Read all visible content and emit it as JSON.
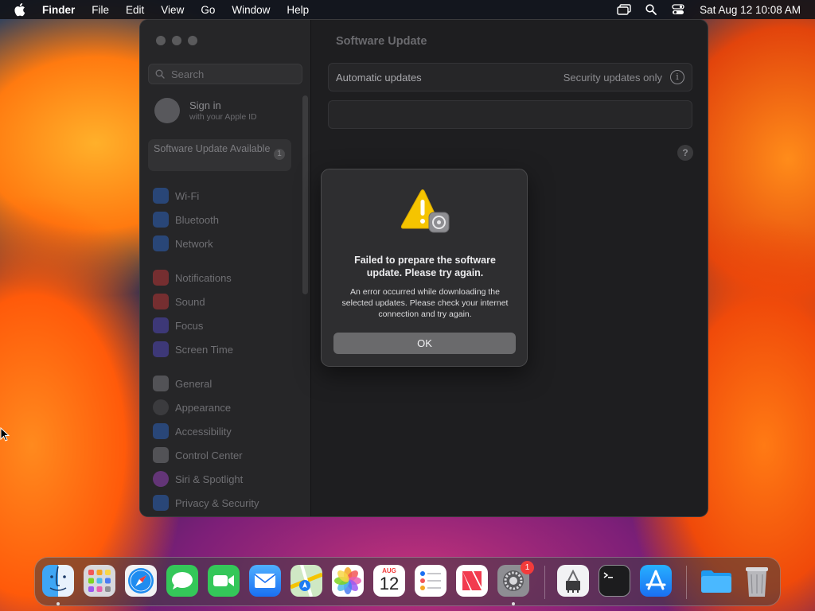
{
  "menubar": {
    "app_name": "Finder",
    "items": [
      "File",
      "Edit",
      "View",
      "Go",
      "Window",
      "Help"
    ],
    "clock": "Sat Aug 12  10:08 AM"
  },
  "sidebar": {
    "search_placeholder": "Search",
    "sign_in_title": "Sign in",
    "sign_in_subtitle": "with your Apple ID",
    "software_update_label": "Software Update Available",
    "software_update_badge": "1",
    "items": [
      {
        "label": "Wi-Fi",
        "color": "#2f6fd6"
      },
      {
        "label": "Bluetooth",
        "color": "#2f6fd6"
      },
      {
        "label": "Network",
        "color": "#2f6fd6"
      },
      {
        "label": "Notifications",
        "color": "#d63a3a"
      },
      {
        "label": "Sound",
        "color": "#d63a3a"
      },
      {
        "label": "Focus",
        "color": "#5a4fd6"
      },
      {
        "label": "Screen Time",
        "color": "#5a4fd6"
      },
      {
        "label": "General",
        "color": "#8a8a8e"
      },
      {
        "label": "Appearance",
        "color": "#2a2a2c"
      },
      {
        "label": "Accessibility",
        "color": "#2f6fd6"
      },
      {
        "label": "Control Center",
        "color": "#8a8a8e"
      },
      {
        "label": "Siri & Spotlight",
        "color": "#b04ad6"
      },
      {
        "label": "Privacy & Security",
        "color": "#2f6fd6"
      }
    ]
  },
  "main": {
    "title": "Software Update",
    "automatic_updates_label": "Automatic updates",
    "automatic_updates_value": "Security updates only",
    "info_glyph": "i",
    "help_glyph": "?"
  },
  "alert": {
    "title": "Failed to prepare the software update. Please try again.",
    "message": "An error occurred while downloading the selected updates. Please check your internet connection and try again.",
    "ok_label": "OK"
  },
  "dock": {
    "calendar_month": "AUG",
    "calendar_day": "12",
    "settings_badge": "1",
    "apps": [
      "finder",
      "launchpad",
      "safari",
      "messages",
      "facetime",
      "mail",
      "maps",
      "photos",
      "calendar",
      "reminders",
      "news",
      "system-settings",
      "system-information",
      "terminal",
      "app-store",
      "downloads-folder",
      "trash"
    ]
  }
}
